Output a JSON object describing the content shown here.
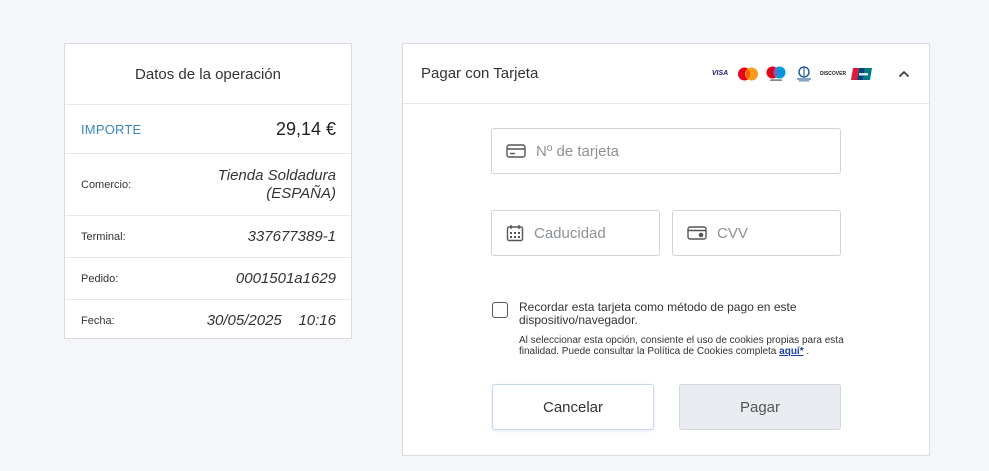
{
  "operation": {
    "title": "Datos de la operación",
    "amount_label": "IMPORTE",
    "amount_value": "29,14 €",
    "merchant_label": "Comercio:",
    "merchant_value_line1": "Tienda Soldadura",
    "merchant_value_line2": "(ESPAÑA)",
    "terminal_label": "Terminal:",
    "terminal_value": "337677389-1",
    "order_label": "Pedido:",
    "order_value": "0001501a1629",
    "date_label": "Fecha:",
    "date_value": "30/05/2025",
    "time_value": "10:16"
  },
  "payment": {
    "title": "Pagar con Tarjeta",
    "brands": {
      "visa": "VISA",
      "discover": "DISCOVER"
    },
    "card_number_placeholder": "Nº de tarjeta",
    "expiry_placeholder": "Caducidad",
    "cvv_placeholder": "CVV",
    "remember_label": "Recordar esta tarjeta como método de pago en este dispositivo/navegador.",
    "remember_note": "Al seleccionar esta opción, consiente el uso de cookies propias para esta finalidad. Puede consultar la Política de Cookies completa",
    "remember_link": "aquí*",
    "remember_note_end": ".",
    "cancel_label": "Cancelar",
    "pay_label": "Pagar"
  },
  "colors": {
    "accent": "#3b86c6",
    "background": "#f4f6f9",
    "link": "#1a3ea8"
  }
}
